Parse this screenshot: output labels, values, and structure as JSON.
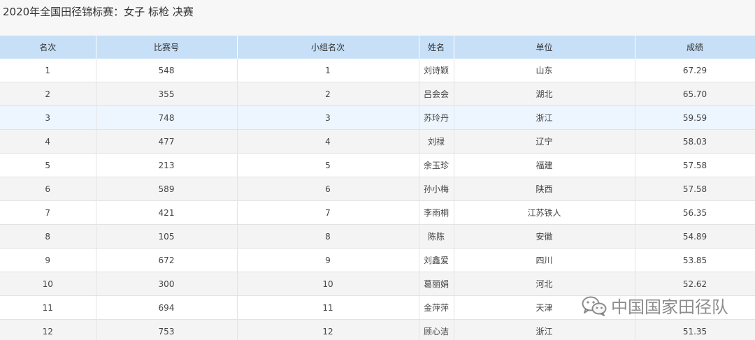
{
  "title": "2020年全国田径锦标赛：女子 标枪 决赛",
  "table": {
    "headers": [
      "名次",
      "比赛号",
      "小组名次",
      "姓名",
      "单位",
      "成绩"
    ],
    "rows": [
      [
        "1",
        "548",
        "1",
        "刘诗颖",
        "山东",
        "67.29"
      ],
      [
        "2",
        "355",
        "2",
        "吕会会",
        "湖北",
        "65.70"
      ],
      [
        "3",
        "748",
        "3",
        "苏玲丹",
        "浙江",
        "59.59"
      ],
      [
        "4",
        "477",
        "4",
        "刘禄",
        "辽宁",
        "58.03"
      ],
      [
        "5",
        "213",
        "5",
        "余玉珍",
        "福建",
        "57.58"
      ],
      [
        "6",
        "589",
        "6",
        "孙小梅",
        "陕西",
        "57.58"
      ],
      [
        "7",
        "421",
        "7",
        "李雨桐",
        "江苏铁人",
        "56.35"
      ],
      [
        "8",
        "105",
        "8",
        "陈陈",
        "安徽",
        "54.89"
      ],
      [
        "9",
        "672",
        "9",
        "刘鑫爱",
        "四川",
        "53.85"
      ],
      [
        "10",
        "300",
        "10",
        "葛丽娟",
        "河北",
        "52.62"
      ],
      [
        "11",
        "694",
        "11",
        "金萍萍",
        "天津",
        ""
      ],
      [
        "12",
        "753",
        "12",
        "顾心洁",
        "浙江",
        "51.35"
      ]
    ]
  },
  "watermark": {
    "text": "中国国家田径队",
    "icon": "wechat-icon"
  },
  "colors": {
    "header_bg": "#c7e0f7",
    "row_alt_bg": "#f4f4f5",
    "row_highlight_bg": "#edf6fe"
  }
}
